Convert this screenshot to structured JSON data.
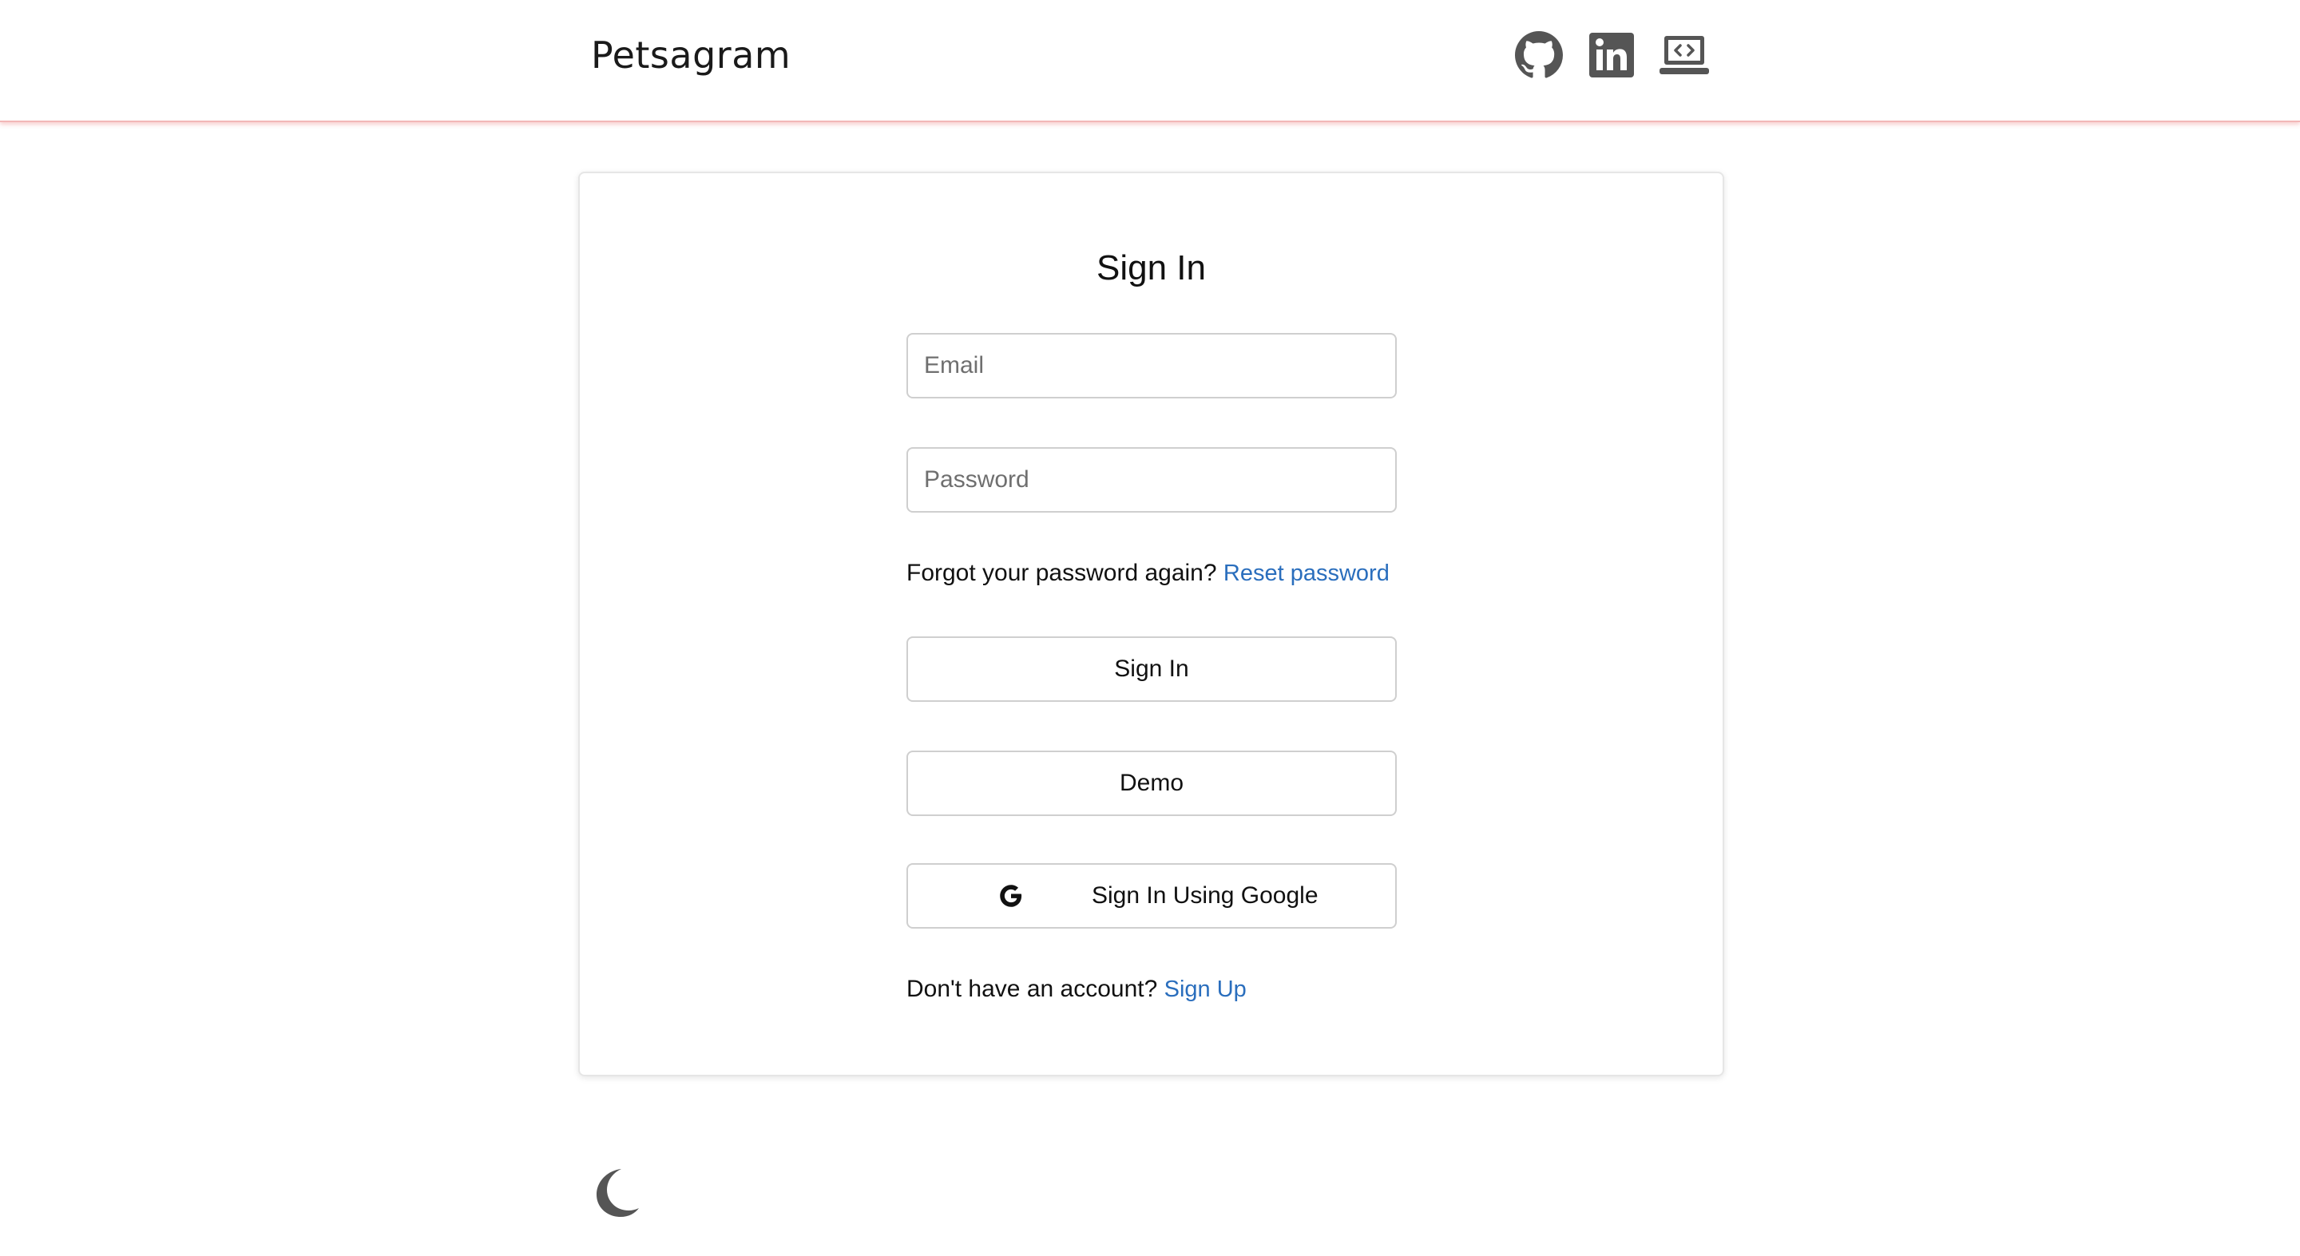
{
  "header": {
    "brand": "Petsagram",
    "icons": [
      "github-icon",
      "linkedin-icon",
      "portfolio-laptop-icon"
    ]
  },
  "signin": {
    "title": "Sign In",
    "email_placeholder": "Email",
    "password_placeholder": "Password",
    "forgot_text": "Forgot your password again?",
    "reset_link": "Reset password",
    "signin_button": "Sign In",
    "demo_button": "Demo",
    "google_icon_letter": "G",
    "google_button": "Sign In Using Google",
    "no_account_text": "Don't have an account?",
    "signup_link": "Sign Up"
  },
  "theme_toggle": {
    "icon": "moon-icon"
  },
  "colors": {
    "link": "#2a6ebd",
    "header_border": "#f2b7b7",
    "icon": "#555555"
  }
}
